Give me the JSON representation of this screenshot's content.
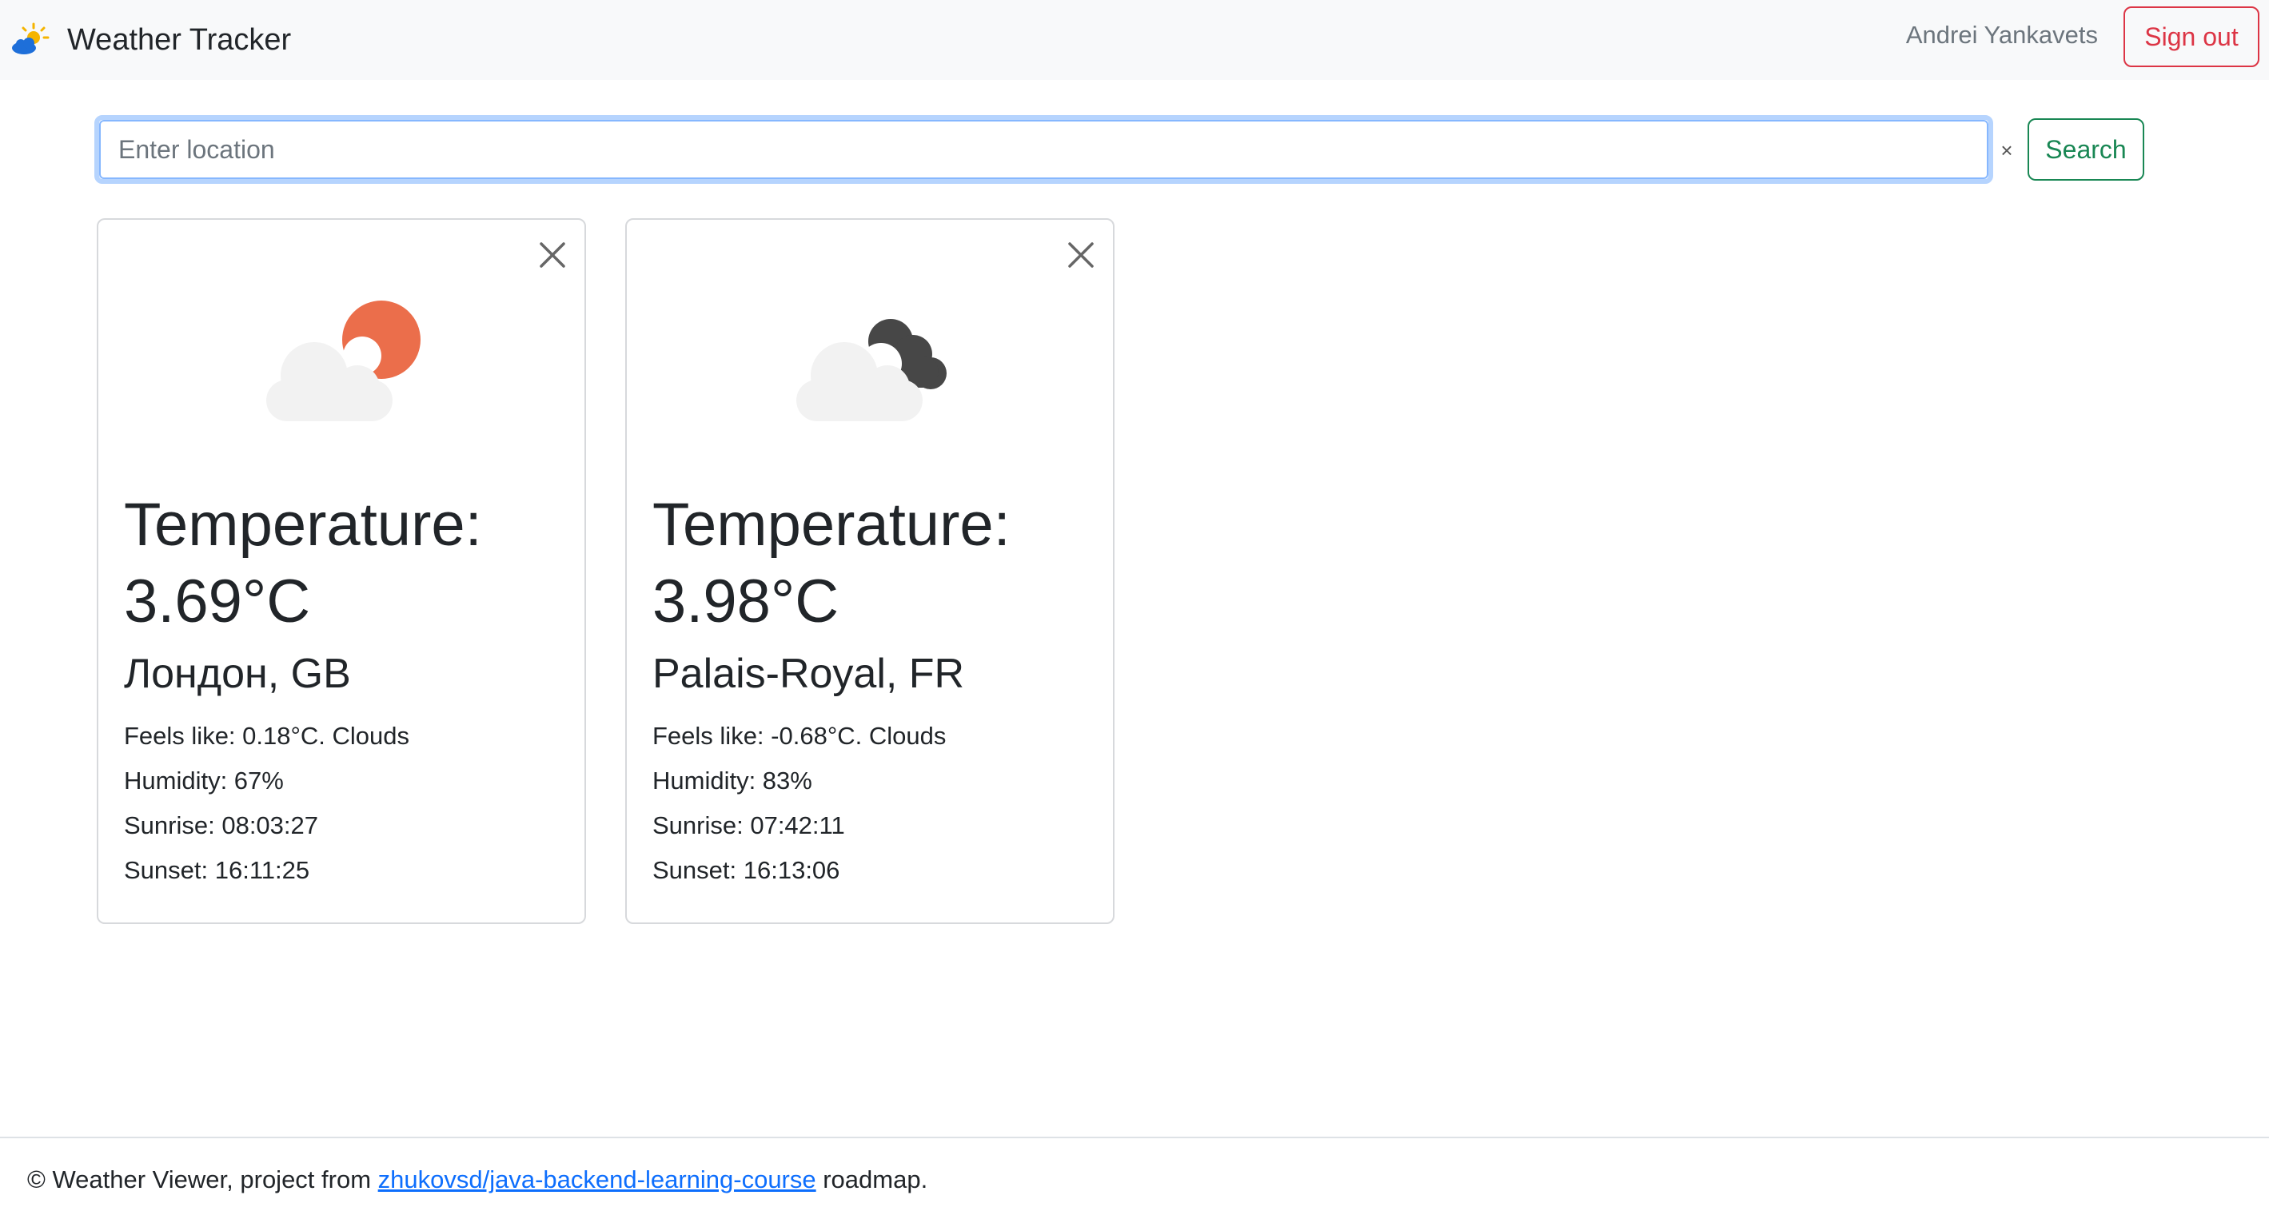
{
  "navbar": {
    "brand": "Weather Tracker",
    "username": "Andrei Yankavets",
    "signout_label": "Sign out"
  },
  "search": {
    "placeholder": "Enter location",
    "value": "",
    "clear_label": "×",
    "button_label": "Search"
  },
  "cards": [
    {
      "temperature": "Temperature: 3.69°C",
      "city": "Лондон, GB",
      "feels_like": "Feels like: 0.18°C. Clouds",
      "humidity": "Humidity: 67%",
      "sunrise": "Sunrise: 08:03:27",
      "sunset": "Sunset: 16:11:25",
      "icon": "cloud-sun-icon"
    },
    {
      "temperature": "Temperature: 3.98°C",
      "city": "Palais-Royal, FR",
      "feels_like": "Feels like: -0.68°C. Clouds",
      "humidity": "Humidity: 83%",
      "sunrise": "Sunrise: 07:42:11",
      "sunset": "Sunset: 16:13:06",
      "icon": "clouds-icon"
    }
  ],
  "footer": {
    "prefix": "© Weather Viewer, project from ",
    "link_text": "zhukovsd/java-backend-learning-course",
    "suffix": " roadmap."
  },
  "colors": {
    "navbar_bg": "#f8f9fa",
    "danger": "#dc3545",
    "success": "#198754",
    "link": "#0d6efd",
    "sun": "#eb6e4b",
    "dark_cloud": "#474747",
    "light_cloud": "#f2f2f2"
  }
}
